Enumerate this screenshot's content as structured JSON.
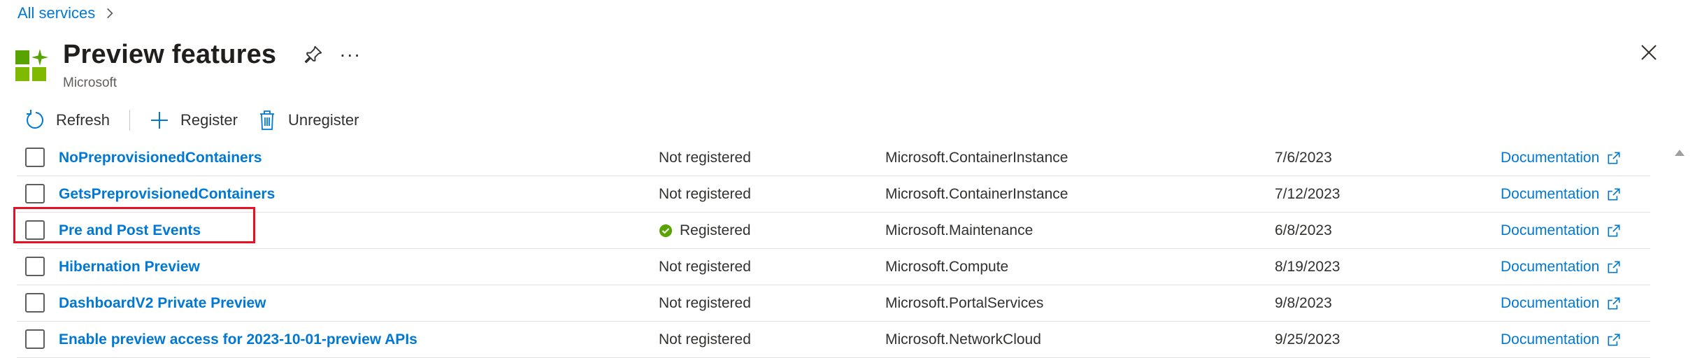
{
  "breadcrumb": {
    "label": "All services"
  },
  "header": {
    "title": "Preview features",
    "subtitle": "Microsoft",
    "more_label": "···"
  },
  "toolbar": {
    "refresh": "Refresh",
    "register": "Register",
    "unregister": "Unregister"
  },
  "rows": [
    {
      "name": "NoPreprovisionedContainers",
      "state": "Not registered",
      "namespace": "Microsoft.ContainerInstance",
      "date": "7/6/2023",
      "doc": "Documentation"
    },
    {
      "name": "GetsPreprovisionedContainers",
      "state": "Not registered",
      "namespace": "Microsoft.ContainerInstance",
      "date": "7/12/2023",
      "doc": "Documentation"
    },
    {
      "name": "Pre and Post Events",
      "state": "Registered",
      "namespace": "Microsoft.Maintenance",
      "date": "6/8/2023",
      "doc": "Documentation"
    },
    {
      "name": "Hibernation Preview",
      "state": "Not registered",
      "namespace": "Microsoft.Compute",
      "date": "8/19/2023",
      "doc": "Documentation"
    },
    {
      "name": "DashboardV2 Private Preview",
      "state": "Not registered",
      "namespace": "Microsoft.PortalServices",
      "date": "9/8/2023",
      "doc": "Documentation"
    },
    {
      "name": "Enable preview access for 2023-10-01-preview APIs",
      "state": "Not registered",
      "namespace": "Microsoft.NetworkCloud",
      "date": "9/25/2023",
      "doc": "Documentation"
    }
  ],
  "colors": {
    "accent": "#0078d4",
    "success": "#57a300",
    "highlight": "#e81123"
  }
}
